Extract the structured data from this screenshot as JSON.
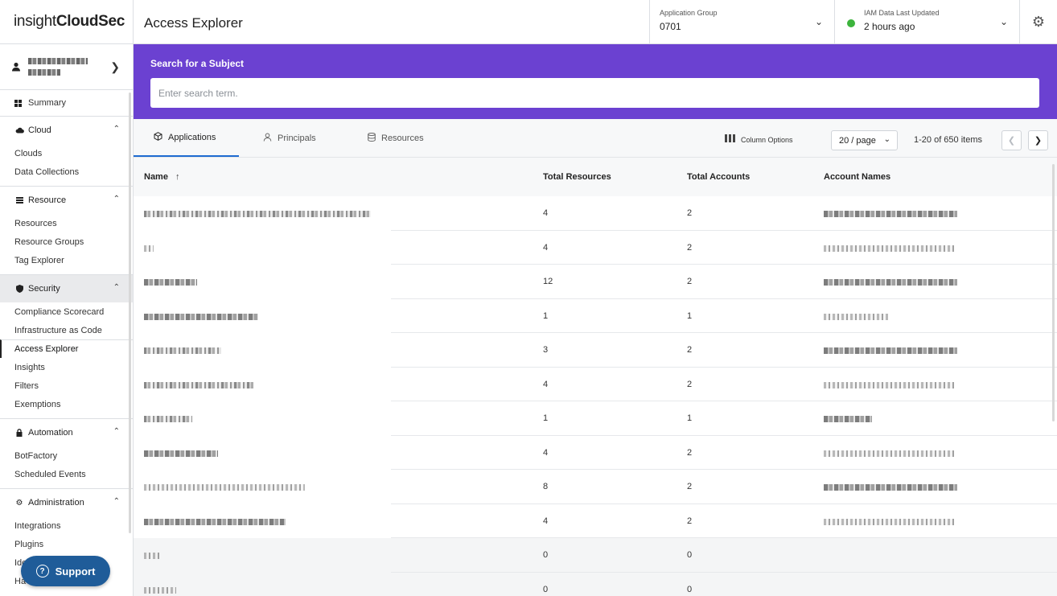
{
  "logo": {
    "light": "insight",
    "bold": "CloudSec"
  },
  "header": {
    "title": "Access Explorer",
    "application_group": {
      "label": "Application Group",
      "value": "0701"
    },
    "iam": {
      "label": "IAM Data Last Updated",
      "value": "2 hours ago",
      "status_color": "#3cb43c"
    },
    "settings_icon": "gear-icon"
  },
  "sidebar": {
    "summary": "Summary",
    "sections": [
      {
        "key": "cloud",
        "label": "Cloud",
        "icon": "cloud-icon",
        "items": [
          "Clouds",
          "Data Collections"
        ]
      },
      {
        "key": "resource",
        "label": "Resource",
        "icon": "list-icon",
        "items": [
          "Resources",
          "Resource Groups",
          "Tag Explorer"
        ]
      },
      {
        "key": "security",
        "label": "Security",
        "icon": "shield-icon",
        "items": [
          "Compliance Scorecard",
          "Infrastructure as Code",
          "Access Explorer",
          "Insights",
          "Filters",
          "Exemptions"
        ]
      },
      {
        "key": "automation",
        "label": "Automation",
        "icon": "lock-icon",
        "items": [
          "BotFactory",
          "Scheduled Events"
        ]
      },
      {
        "key": "administration",
        "label": "Administration",
        "icon": "gear-icon",
        "items": [
          "Integrations",
          "Plugins",
          "Ide",
          "Ha"
        ]
      }
    ],
    "current_item": "Access Explorer"
  },
  "support": {
    "label": "Support"
  },
  "search": {
    "label": "Search for a Subject",
    "placeholder": "Enter search term."
  },
  "tabs": {
    "applications": "Applications",
    "principals": "Principals",
    "resources": "Resources"
  },
  "toolbar": {
    "column_options": "Column Options",
    "page_size": "20 / page",
    "items_count": "1-20 of 650 items"
  },
  "table": {
    "columns": {
      "name": "Name",
      "total_resources": "Total Resources",
      "total_accounts": "Total Accounts",
      "account_names": "Account Names"
    },
    "rows": [
      {
        "total_resources": "4",
        "total_accounts": "2"
      },
      {
        "total_resources": "4",
        "total_accounts": "2"
      },
      {
        "total_resources": "12",
        "total_accounts": "2"
      },
      {
        "total_resources": "1",
        "total_accounts": "1"
      },
      {
        "total_resources": "3",
        "total_accounts": "2"
      },
      {
        "total_resources": "4",
        "total_accounts": "2"
      },
      {
        "total_resources": "1",
        "total_accounts": "1"
      },
      {
        "total_resources": "4",
        "total_accounts": "2"
      },
      {
        "total_resources": "8",
        "total_accounts": "2"
      },
      {
        "total_resources": "4",
        "total_accounts": "2"
      },
      {
        "total_resources": "0",
        "total_accounts": "0"
      },
      {
        "total_resources": "0",
        "total_accounts": "0"
      }
    ]
  },
  "colors": {
    "accent_purple": "#6b41d1",
    "tab_underline": "#1f6bd1",
    "support_button": "#1f5c99"
  }
}
